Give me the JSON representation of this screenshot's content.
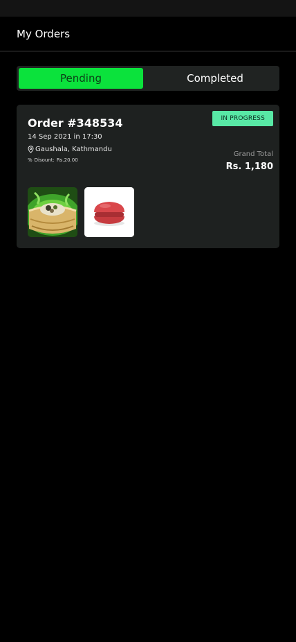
{
  "header": {
    "title": "My Orders"
  },
  "tabs": [
    {
      "label": "Pending",
      "active": true
    },
    {
      "label": "Completed",
      "active": false
    }
  ],
  "orders": [
    {
      "number": "Order #348534",
      "date": "14 Sep 2021 in 17:30",
      "location": "Gaushala, Kathmandu",
      "discount_label": "Disount:",
      "discount_value": "Rs.20.00",
      "status": "IN PROGRESS",
      "total_label": "Grand Total",
      "total_value": "Rs. 1,180",
      "items": [
        {
          "icon": "dumpling-basket-image"
        },
        {
          "icon": "macaron-image"
        }
      ]
    }
  ],
  "colors": {
    "accent": "#0be23c",
    "status_badge": "#58e8a5",
    "card": "#1e2120",
    "background": "#000000"
  }
}
